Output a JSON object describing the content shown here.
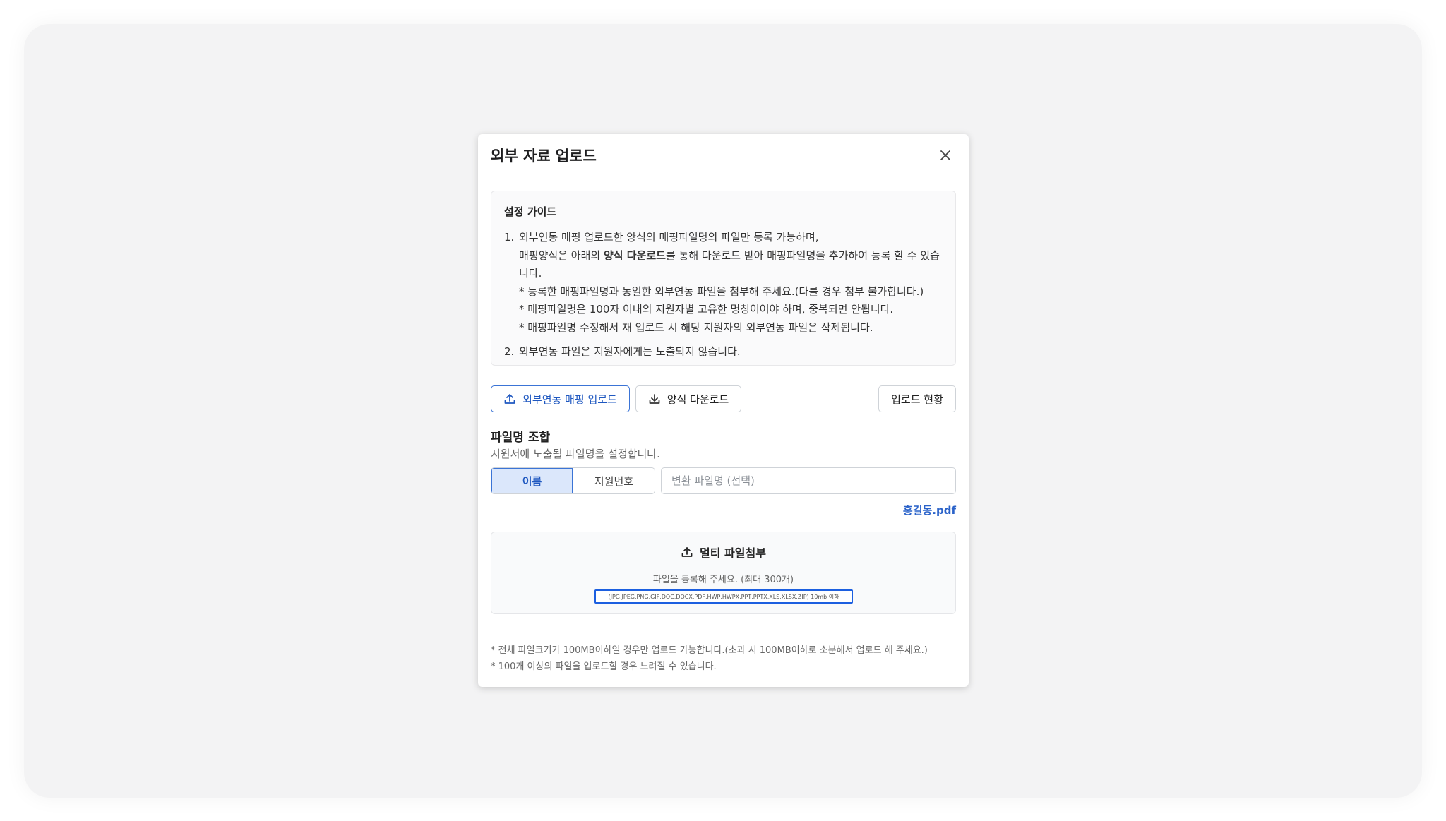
{
  "modal": {
    "title": "외부 자료 업로드"
  },
  "guide": {
    "title": "설정 가이드",
    "items": [
      {
        "num": "1.",
        "line1": "외부연동 매핑 업로드한 양식의 매핑파일명의 파일만 등록 가능하며,",
        "line2_pre": "매핑양식은 아래의 ",
        "line2_bold": "양식 다운로드",
        "line2_post": "를 통해 다운로드 받아 매핑파일명을 추가하여 등록 할 수 있습니다.",
        "note1": "* 등록한 매핑파일명과 동일한 외부연동 파일을 첨부해 주세요.(다를 경우 첨부 불가합니다.)",
        "note2": "* 매핑파일명은 100자 이내의 지원자별 고유한 명칭이어야 하며, 중복되면 안됩니다.",
        "note3": "* 매핑파일명 수정해서 재 업로드 시 해당 지원자의 외부연동 파일은 삭제됩니다."
      },
      {
        "num": "2.",
        "line1": "외부연동 파일은 지원자에게는 노출되지 않습니다."
      }
    ]
  },
  "buttons": {
    "mapping_upload": "외부연동 매핑 업로드",
    "template_download": "양식 다운로드",
    "upload_status": "업로드 현황"
  },
  "filename": {
    "title": "파일명 조합",
    "subtitle": "지원서에 노출될 파일명을 설정합니다.",
    "options": [
      "이름",
      "지원번호"
    ],
    "selected": "이름",
    "input_placeholder": "변환 파일명 (선택)",
    "input_value": "",
    "preview": "홍길동.pdf"
  },
  "dropzone": {
    "title": "멀티 파일첨부",
    "hint": "파일을 등록해 주세요. (최대 300개)",
    "types": "(JPG,JPEG,PNG,GIF,DOC,DOCX,PDF,HWP,HWPX,PPT,PPTX,XLS,XLSX,ZIP) 10mb 이하"
  },
  "notes": [
    "* 전체 파일크기가 100MB이하일 경우만 업로드 가능합니다.(초과 시 100MB이하로 소분해서 업로드 해 주세요.)",
    "* 100개 이상의 파일을 업로드할 경우 느려질 수 있습니다."
  ],
  "colors": {
    "accent": "#1f58c0",
    "accent_bg": "#dbe7fb",
    "highlight": "#1c5fe0"
  }
}
